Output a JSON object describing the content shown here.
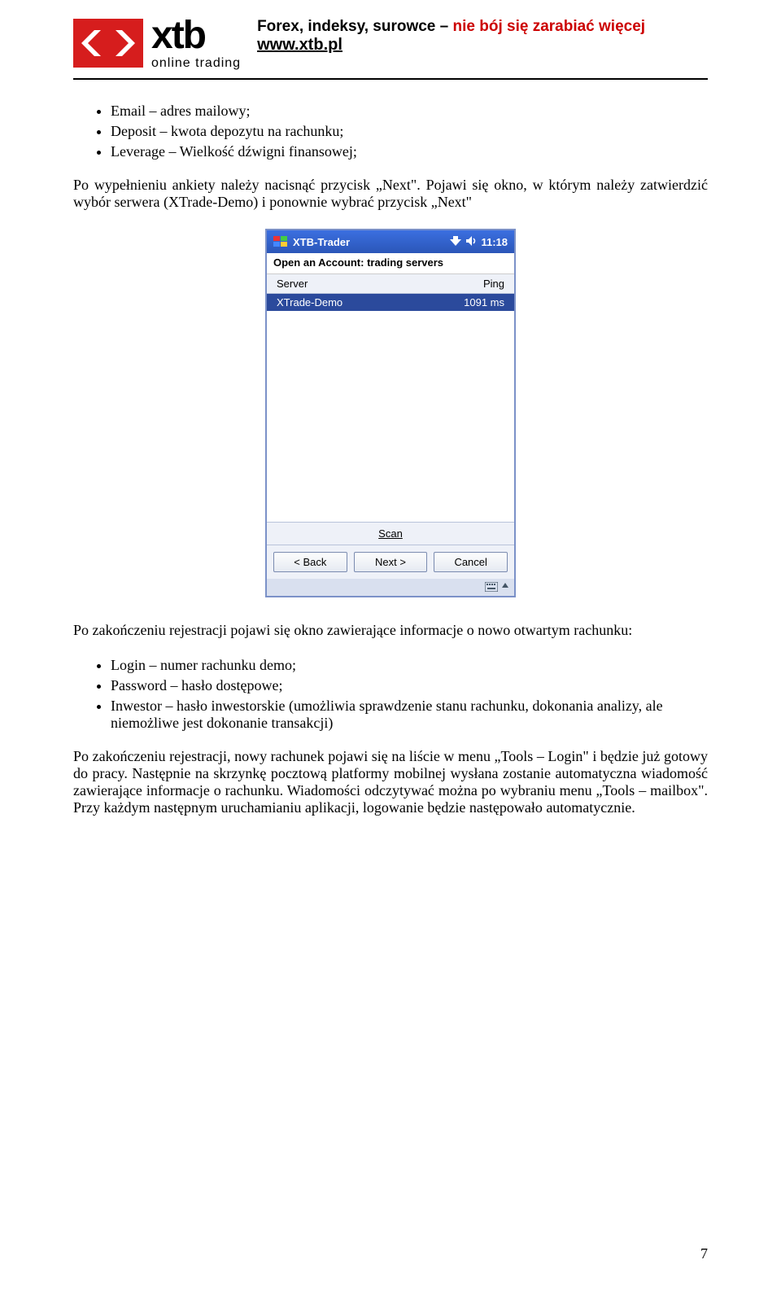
{
  "header": {
    "logo_main": "xtb",
    "logo_sub": "online trading",
    "tagline_black": "Forex, indeksy, surowce – ",
    "tagline_red": "nie bój się zarabiać więcej",
    "url": "www.xtb.pl"
  },
  "bullets1": [
    "Email – adres mailowy;",
    "Deposit – kwota depozytu na rachunku;",
    "Leverage – Wielkość dźwigni finansowej;"
  ],
  "para1": "Po wypełnieniu ankiety należy nacisnąć przycisk „Next\". Pojawi się okno, w którym należy zatwierdzić wybór serwera (XTrade-Demo) i ponownie wybrać przycisk „Next\"",
  "phone": {
    "app_title": "XTB-Trader",
    "clock": "11:18",
    "subtitle": "Open an Account: trading servers",
    "col_server": "Server",
    "col_ping": "Ping",
    "row_server": "XTrade-Demo",
    "row_ping": "1091 ms",
    "scan": "Scan",
    "btn_back": "< Back",
    "btn_next": "Next >",
    "btn_cancel": "Cancel"
  },
  "para2": "Po zakończeniu rejestracji pojawi się okno zawierające informacje o nowo otwartym rachunku:",
  "bullets2": [
    "Login – numer rachunku demo;",
    "Password – hasło dostępowe;",
    "Inwestor – hasło inwestorskie (umożliwia sprawdzenie stanu rachunku, dokonania analizy, ale niemożliwe jest dokonanie transakcji)"
  ],
  "para3": "Po zakończeniu rejestracji, nowy rachunek pojawi się na liście w menu „Tools – Login\" i będzie już gotowy do pracy. Następnie na skrzynkę pocztową platformy mobilnej wysłana zostanie automatyczna wiadomość zawierające informacje o rachunku. Wiadomości odczytywać można po wybraniu menu „Tools – mailbox\". Przy każdym następnym uruchamianiu aplikacji, logowanie będzie następowało automatycznie.",
  "page_number": "7"
}
